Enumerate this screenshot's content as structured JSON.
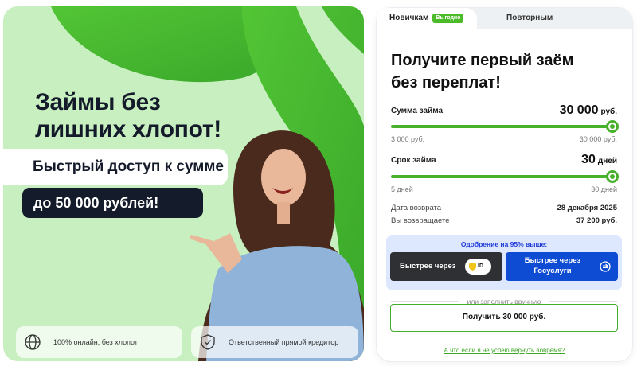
{
  "hero": {
    "title_line1": "Займы без",
    "title_line2": "лишних хлопот!",
    "subtitle": "Быстрый доступ к сумме",
    "highlight": "до 50 000 рублей!",
    "features": [
      {
        "icon": "globe-icon",
        "text": "100% онлайн, без хлопот"
      },
      {
        "icon": "shield-check-icon",
        "text": "Ответственный прямой кредитор"
      }
    ]
  },
  "tabs": {
    "new_label": "Новичкам",
    "new_badge": "Выгодно",
    "repeat_label": "Повторным"
  },
  "form": {
    "title_line1": "Получите первый заём",
    "title_line2": "без переплат!",
    "amount": {
      "label": "Сумма займа",
      "value": "30 000",
      "unit": "руб.",
      "min": "3 000 руб.",
      "max": "30 000 руб.",
      "level": 1.0
    },
    "term": {
      "label": "Срок займа",
      "value": "30",
      "unit": "дней",
      "min": "5 дней",
      "max": "30 дней",
      "level": 1.0
    },
    "return_date_label": "Дата возврата",
    "return_date_value": "28 декабря 2025",
    "return_sum_label": "Вы возвращаете",
    "return_sum_value": "37 200 руб.",
    "approval_title": "Одобрение на 95% выше:",
    "btn_id_label": "Быстрее через",
    "btn_id_badge": "ID",
    "btn_gos_line1": "Быстрее через",
    "btn_gos_line2": "Госуслуги",
    "divider": "или заполнить вручную",
    "get_button": "Получить 30 000 руб.",
    "help_link": "А что если я не успею вернуть вовремя?"
  },
  "colors": {
    "accent_green": "#47b12c",
    "hero_bg": "#c7efbf",
    "gos_blue": "#0d4cd3",
    "dark": "#141c2b"
  }
}
